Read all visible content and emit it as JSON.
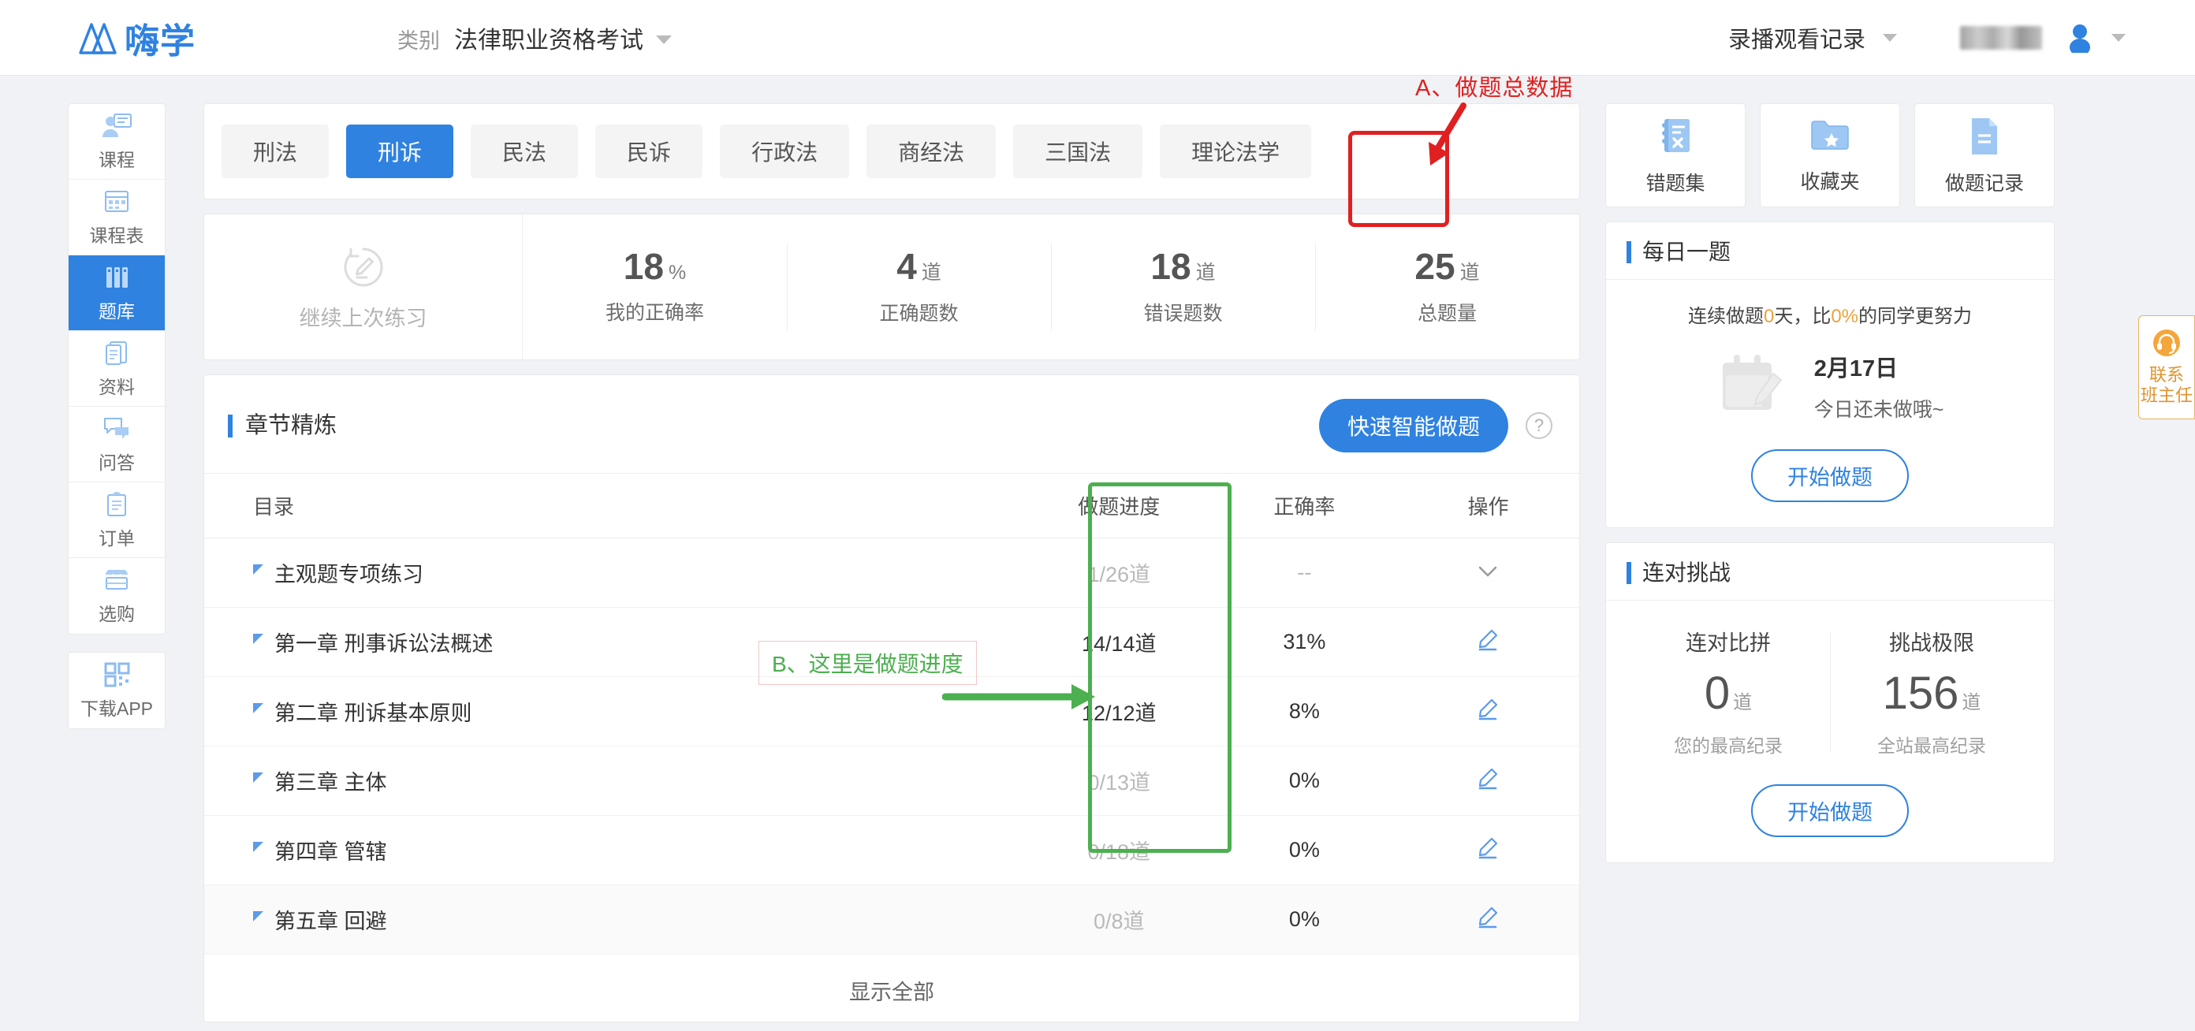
{
  "header": {
    "logo_text": "嗨学",
    "logo_icon": "mountain-logo-icon",
    "category_label": "类别",
    "category_value": "法律职业资格考试",
    "category_caret_icon": "chevron-down-icon",
    "records_label": "录播观看记录",
    "records_caret_icon": "chevron-down-icon",
    "avatar_icon": "user-avatar-icon",
    "user_caret_icon": "chevron-down-icon"
  },
  "sidebar": {
    "items": [
      {
        "label": "课程",
        "icon": "presenter-icon",
        "active": false
      },
      {
        "label": "课程表",
        "icon": "calendar-grid-icon",
        "active": false
      },
      {
        "label": "题库",
        "icon": "bars-icon",
        "active": true
      },
      {
        "label": "资料",
        "icon": "documents-icon",
        "active": false
      },
      {
        "label": "问答",
        "icon": "chat-bubbles-icon",
        "active": false
      },
      {
        "label": "订单",
        "icon": "clipboard-icon",
        "active": false
      },
      {
        "label": "选购",
        "icon": "shop-icon",
        "active": false
      }
    ],
    "app_item": {
      "label": "下载APP",
      "icon": "qr-code-icon"
    }
  },
  "subject_tabs": [
    {
      "label": "刑法",
      "active": false
    },
    {
      "label": "刑诉",
      "active": true
    },
    {
      "label": "民法",
      "active": false
    },
    {
      "label": "民诉",
      "active": false
    },
    {
      "label": "行政法",
      "active": false
    },
    {
      "label": "商经法",
      "active": false
    },
    {
      "label": "三国法",
      "active": false
    },
    {
      "label": "理论法学",
      "active": false
    }
  ],
  "stats": {
    "resume_label": "继续上次练习",
    "resume_icon": "resume-pencil-icon",
    "cells": [
      {
        "value": "18",
        "unit": "%",
        "caption": "我的正确率",
        "highlighted": false
      },
      {
        "value": "4",
        "unit": "道",
        "caption": "正确题数",
        "highlighted": false
      },
      {
        "value": "18",
        "unit": "道",
        "caption": "错误题数",
        "highlighted": false
      },
      {
        "value": "25",
        "unit": "道",
        "caption": "总题量",
        "highlighted": true
      }
    ]
  },
  "annotations": {
    "a_text": "A、做题总数据",
    "a_color": "#e02020",
    "b_text": "B、这里是做题进度",
    "b_color": "#4caf50"
  },
  "chapter_section": {
    "title": "章节精炼",
    "smart_button": "快速智能做题",
    "help_icon": "question-mark-icon",
    "columns": [
      "目录",
      "做题进度",
      "正确率",
      "操作"
    ],
    "rows": [
      {
        "name": "主观题专项练习",
        "progress": "1/26道",
        "progress_dim": true,
        "accuracy": "--",
        "accuracy_dim": true,
        "action_icon": "chevron-down-icon",
        "highlight": false
      },
      {
        "name": "第一章  刑事诉讼法概述",
        "progress": "14/14道",
        "progress_dim": false,
        "accuracy": "31%",
        "accuracy_dim": false,
        "action_icon": "edit-pencil-icon",
        "highlight": false
      },
      {
        "name": "第二章  刑诉基本原则",
        "progress": "12/12道",
        "progress_dim": false,
        "accuracy": "8%",
        "accuracy_dim": false,
        "action_icon": "edit-pencil-icon",
        "highlight": false
      },
      {
        "name": "第三章  主体",
        "progress": "0/13道",
        "progress_dim": true,
        "accuracy": "0%",
        "accuracy_dim": false,
        "action_icon": "edit-pencil-icon",
        "highlight": false
      },
      {
        "name": "第四章  管辖",
        "progress": "0/18道",
        "progress_dim": true,
        "accuracy": "0%",
        "accuracy_dim": false,
        "action_icon": "edit-pencil-icon",
        "highlight": false
      },
      {
        "name": "第五章  回避",
        "progress": "0/8道",
        "progress_dim": true,
        "accuracy": "0%",
        "accuracy_dim": false,
        "action_icon": "edit-pencil-icon",
        "highlight": true
      }
    ],
    "show_all": "显示全部"
  },
  "quick_cards": [
    {
      "label": "错题集",
      "icon": "wrong-book-icon"
    },
    {
      "label": "收藏夹",
      "icon": "star-folder-icon"
    },
    {
      "label": "做题记录",
      "icon": "record-doc-icon"
    }
  ],
  "daily": {
    "title": "每日一题",
    "streak_prefix": "连续做题",
    "streak_days": "0",
    "streak_mid": "天，比",
    "streak_pct": "0%",
    "streak_suffix": "的同学更努力",
    "calendar_icon": "calendar-pencil-icon",
    "date": "2月17日",
    "status": "今日还未做哦~",
    "button": "开始做题"
  },
  "streak_challenge": {
    "title": "连对挑战",
    "cells": [
      {
        "caption": "连对比拼",
        "value": "0",
        "unit": "道",
        "sub": "您的最高纪录"
      },
      {
        "caption": "挑战极限",
        "value": "156",
        "unit": "道",
        "sub": "全站最高纪录"
      }
    ],
    "button": "开始做题"
  },
  "contact_widget": {
    "icon": "headset-icon",
    "line1": "联系",
    "line2": "班主任"
  },
  "colors": {
    "accent": "#2f82e0",
    "annotation_red": "#e02020",
    "annotation_green": "#4caf50",
    "warn_orange": "#e8a33d"
  }
}
